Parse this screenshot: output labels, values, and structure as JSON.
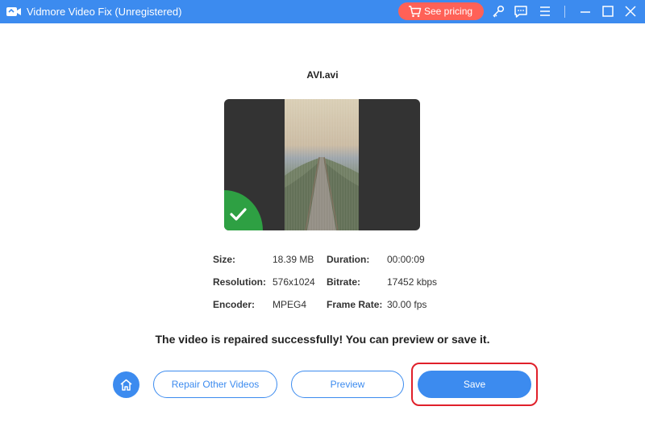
{
  "titlebar": {
    "title": "Vidmore Video Fix (Unregistered)",
    "pricing_label": "See pricing",
    "icons": [
      "key-icon",
      "feedback-icon",
      "menu-icon",
      "minimize-icon",
      "maximize-icon",
      "close-icon"
    ],
    "color": "#3c8bef",
    "pricing_color": "#ff6157"
  },
  "file": {
    "name": "AVI.avi"
  },
  "info": {
    "size_label": "Size:",
    "size_value": "18.39 MB",
    "duration_label": "Duration:",
    "duration_value": "00:00:09",
    "resolution_label": "Resolution:",
    "resolution_value": "576x1024",
    "bitrate_label": "Bitrate:",
    "bitrate_value": "17452 kbps",
    "encoder_label": "Encoder:",
    "encoder_value": "MPEG4",
    "framerate_label": "Frame Rate:",
    "framerate_value": "30.00 fps"
  },
  "message": "The video is repaired successfully! You can preview or save it.",
  "actions": {
    "repair_other_label": "Repair Other Videos",
    "preview_label": "Preview",
    "save_label": "Save",
    "highlight_color": "#e0202a"
  }
}
